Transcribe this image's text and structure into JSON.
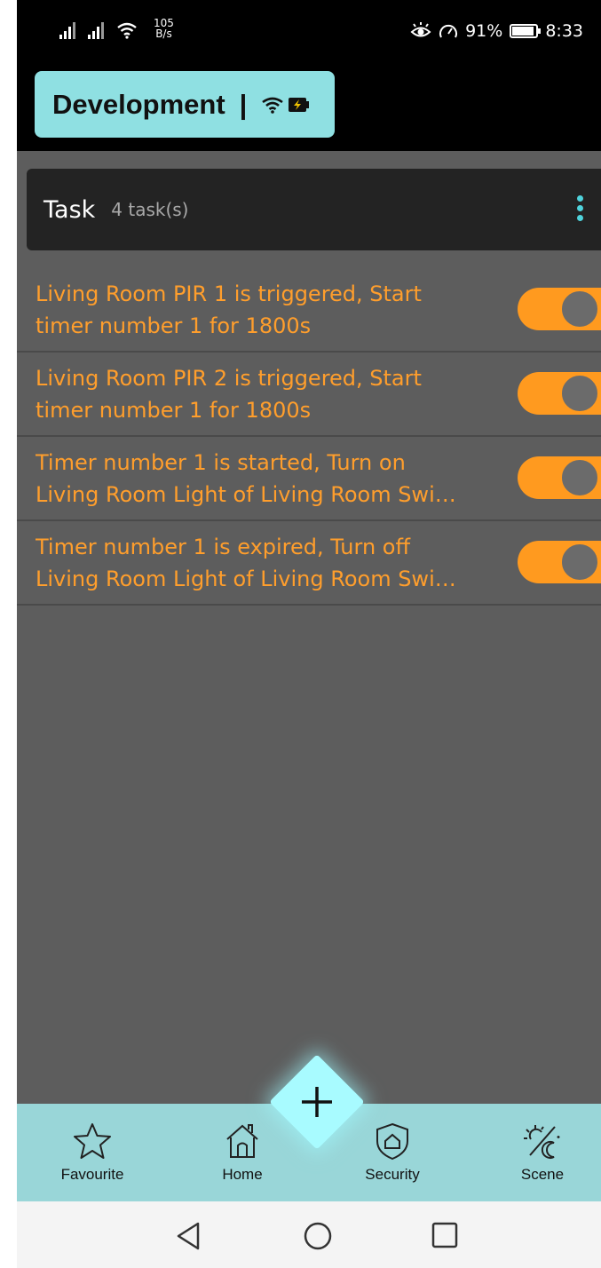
{
  "status_bar": {
    "net_speed_value": "105",
    "net_speed_unit": "B/s",
    "battery_percent": "91%",
    "battery_level": 0.91,
    "time": "8:33"
  },
  "header": {
    "title": "Development",
    "separator": "|"
  },
  "task_section": {
    "title": "Task",
    "count": "4 task(s)"
  },
  "tasks": [
    {
      "line1": "Living Room PIR 1 is triggered, Start",
      "line2": "timer number 1 for 1800s",
      "enabled": true
    },
    {
      "line1": "Living Room PIR 2 is triggered, Start",
      "line2": "timer number 1 for 1800s",
      "enabled": true
    },
    {
      "line1": "Timer number 1 is started, Turn on",
      "line2": "Living Room Light of Living Room Swi…",
      "enabled": true
    },
    {
      "line1": "Timer number 1 is expired, Turn off",
      "line2": "Living Room Light of Living Room Swi…",
      "enabled": true
    }
  ],
  "bottom_nav": {
    "favourite": "Favourite",
    "home": "Home",
    "security": "Security",
    "scene": "Scene"
  },
  "colors": {
    "accent_orange": "#ff9a1f",
    "header_cyan": "#8fe0e2",
    "nav_bg": "#99d6d8",
    "fab": "#a8fbff"
  }
}
